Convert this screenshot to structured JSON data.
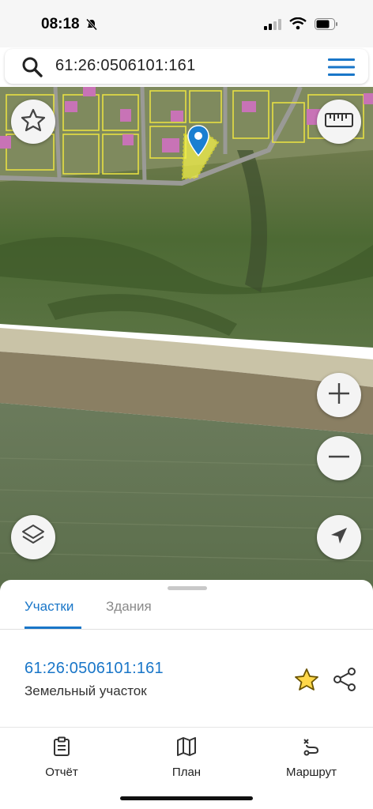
{
  "status_bar": {
    "time": "08:18",
    "icons": [
      "bell-muted-icon",
      "signal-icon",
      "wifi-icon",
      "battery-icon"
    ]
  },
  "search": {
    "value": "61:26:0506101:161",
    "icon": "search-icon",
    "menu_icon": "hamburger-menu-icon"
  },
  "map": {
    "controls": [
      "star-icon",
      "ruler-icon",
      "zoom-in-icon",
      "zoom-out-icon",
      "layers-icon",
      "location-arrow-icon"
    ],
    "highlight_color": "#f2f04a",
    "marker_color": "#1a7fd1"
  },
  "sheet": {
    "tabs": [
      {
        "label": "Участки",
        "active": true
      },
      {
        "label": "Здания",
        "active": false
      }
    ],
    "parcel": {
      "id": "61:26:0506101:161",
      "type": "Земельный участок"
    }
  },
  "bottom_nav": [
    {
      "label": "Отчёт",
      "icon": "report-icon"
    },
    {
      "label": "План",
      "icon": "map-plan-icon"
    },
    {
      "label": "Маршрут",
      "icon": "route-icon"
    }
  ],
  "colors": {
    "accent": "#1976c8",
    "favorite": "#e0b400"
  }
}
